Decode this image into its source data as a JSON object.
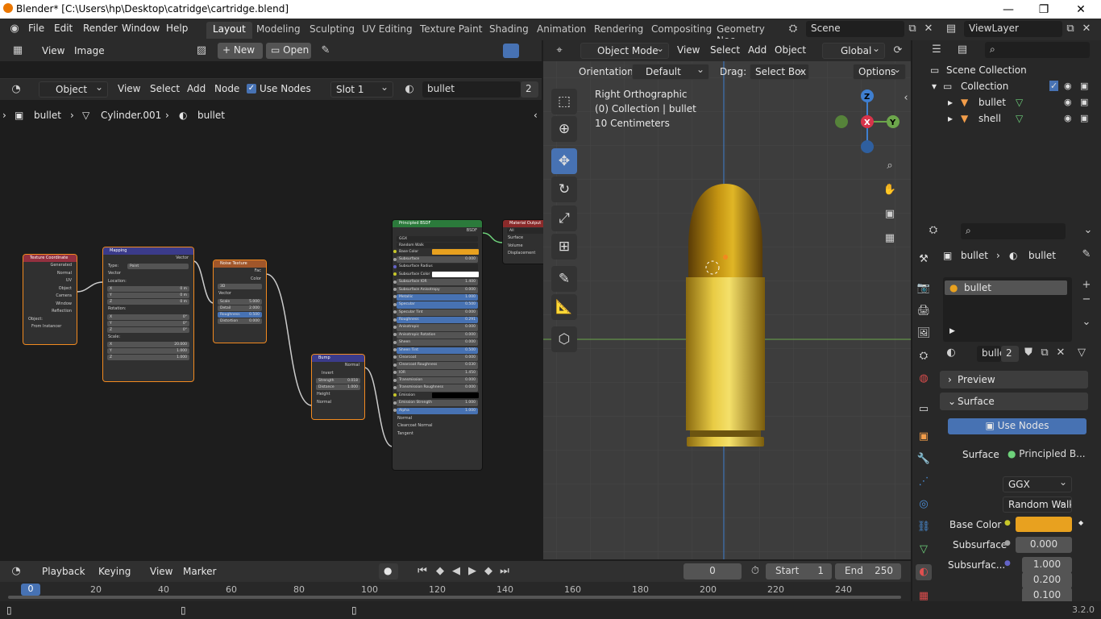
{
  "title_bar": {
    "title": "Blender* [C:\\Users\\hp\\Desktop\\catridge\\cartridge.blend]",
    "minimize": "—",
    "maximize": "❐",
    "close": "✕"
  },
  "menu": [
    "File",
    "Edit",
    "Render",
    "Window",
    "Help"
  ],
  "workspaces": [
    "Layout",
    "Modeling",
    "Sculpting",
    "UV Editing",
    "Texture Paint",
    "Shading",
    "Animation",
    "Rendering",
    "Compositing",
    "Geometry Noc"
  ],
  "scene": "Scene",
  "view_layer": "ViewLayer",
  "image_editor": {
    "view": "View",
    "image": "Image",
    "new": "New",
    "open": "Open"
  },
  "node_editor": {
    "mode": "Object",
    "view": "View",
    "select": "Select",
    "add": "Add",
    "node": "Node",
    "use_nodes": "Use Nodes",
    "slot": "Slot 1",
    "material": "bullet",
    "users": "2",
    "breadcrumb": [
      "bullet",
      "Cylinder.001",
      "bullet"
    ]
  },
  "nodes": {
    "texcoord": {
      "title": "Texture Coordinate",
      "outputs": [
        "Generated",
        "Normal",
        "UV",
        "Object",
        "Camera",
        "Window",
        "Reflection"
      ],
      "object_label": "Object:",
      "from_instancer": "From Instancer"
    },
    "mapping": {
      "title": "Mapping",
      "vector_out": "Vector",
      "type_label": "Type:",
      "type": "Point",
      "vector_in": "Vector",
      "location": "Location:",
      "rotation": "Rotation:",
      "scale": "Scale:",
      "loc": [
        [
          "X",
          "0 m"
        ],
        [
          "Y",
          "0 m"
        ],
        [
          "Z",
          "0 m"
        ]
      ],
      "rot": [
        [
          "X",
          "0°"
        ],
        [
          "Y",
          "0°"
        ],
        [
          "Z",
          "0°"
        ]
      ],
      "scl": [
        [
          "X",
          "20.000"
        ],
        [
          "Y",
          "1.000"
        ],
        [
          "Z",
          "1.000"
        ]
      ]
    },
    "noise": {
      "title": "Noise Texture",
      "fac": "Fac",
      "color": "Color",
      "dim": "3D",
      "vector": "Vector",
      "fields": [
        [
          "Scale",
          "5.000"
        ],
        [
          "Detail",
          "2.000"
        ],
        [
          "Roughness",
          "0.500"
        ],
        [
          "Distortion",
          "0.000"
        ]
      ]
    },
    "bump": {
      "title": "Bump",
      "normal_out": "Normal",
      "invert": "Invert",
      "fields": [
        [
          "Strength",
          "0.018"
        ],
        [
          "Distance",
          "1.000"
        ]
      ],
      "height": "Height",
      "normal_in": "Normal"
    },
    "bsdf": {
      "title": "Principled BSDF",
      "bsdf_out": "BSDF",
      "dist": "GGX",
      "sss": "Random Walk",
      "rows": [
        [
          "Base Color",
          ""
        ],
        [
          "Subsurface",
          "0.000"
        ],
        [
          "Subsurface Radius",
          ""
        ],
        [
          "Subsurface Color",
          ""
        ],
        [
          "Subsurface IOR",
          "1.400"
        ],
        [
          "Subsurface Anisotropy",
          "0.000"
        ],
        [
          "Metallic",
          "1.000"
        ],
        [
          "Specular",
          "0.500"
        ],
        [
          "Specular Tint",
          "0.000"
        ],
        [
          "Roughness",
          "0.291"
        ],
        [
          "Anisotropic",
          "0.000"
        ],
        [
          "Anisotropic Rotation",
          "0.000"
        ],
        [
          "Sheen",
          "0.000"
        ],
        [
          "Sheen Tint",
          "0.500"
        ],
        [
          "Clearcoat",
          "0.000"
        ],
        [
          "Clearcoat Roughness",
          "0.030"
        ],
        [
          "IOR",
          "1.450"
        ],
        [
          "Transmission",
          "0.000"
        ],
        [
          "Transmission Roughness",
          "0.000"
        ],
        [
          "Emission",
          ""
        ],
        [
          "Emission Strength",
          "1.000"
        ],
        [
          "Alpha",
          "1.000"
        ]
      ],
      "tail": [
        "Normal",
        "Clearcoat Normal",
        "Tangent"
      ]
    },
    "output": {
      "title": "Material Output",
      "target": "All",
      "rows": [
        "Surface",
        "Volume",
        "Displacement"
      ]
    }
  },
  "viewport": {
    "mode": "Object Mode",
    "view": "View",
    "select": "Select",
    "add": "Add",
    "object": "Object",
    "transform": "Global",
    "orientation_label": "Orientation:",
    "orientation": "Default",
    "drag_label": "Drag:",
    "drag": "Select Box",
    "options": "Options",
    "info": [
      "Right Orthographic",
      "(0) Collection | bullet",
      "10 Centimeters"
    ],
    "gizmo": {
      "z": "Z",
      "x": "X",
      "y": "Y"
    }
  },
  "outliner": {
    "scene_collection": "Scene Collection",
    "collection": "Collection",
    "objects": [
      "bullet",
      "shell"
    ]
  },
  "properties": {
    "breadcrumb": [
      "bullet",
      "bullet"
    ],
    "slot": "bullet",
    "material": "bullet",
    "users": "2",
    "preview": "Preview",
    "surface_panel": "Surface",
    "use_nodes": "Use Nodes",
    "surface_label": "Surface",
    "surface_value": "Principled B...",
    "dist": "GGX",
    "sss": "Random Walk",
    "base_color_label": "Base Color",
    "base_color": "#e8a11f",
    "subsurface_label": "Subsurface",
    "subsurface": "0.000",
    "subsurf_radius_label": "Subsurfac...",
    "radius": [
      "1.000",
      "0.200",
      "0.100"
    ]
  },
  "timeline": {
    "playback": "Playback",
    "keying": "Keying",
    "view": "View",
    "marker": "Marker",
    "frame": "0",
    "start_label": "Start",
    "start": "1",
    "end_label": "End",
    "end": "250",
    "current": "0",
    "ticks": [
      "20",
      "40",
      "60",
      "80",
      "100",
      "120",
      "140",
      "160",
      "180",
      "200",
      "220",
      "240"
    ]
  },
  "status": {
    "version": "3.2.0"
  },
  "colors": {
    "accent": "#4772b3",
    "selected": "#f28a20",
    "brass": "#d6b23a"
  }
}
